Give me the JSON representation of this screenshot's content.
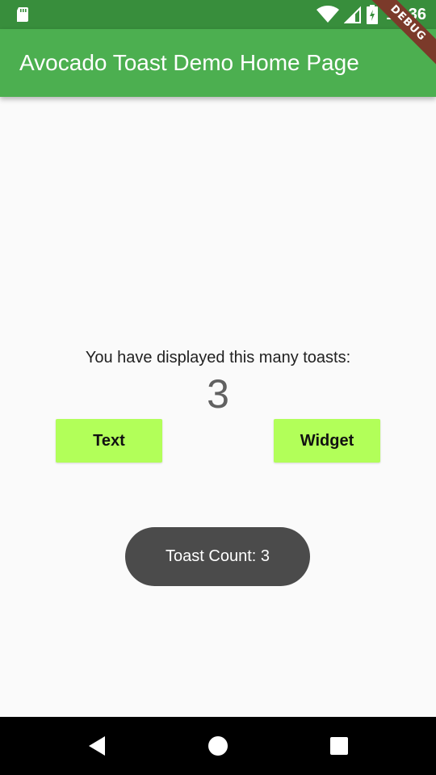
{
  "status_bar": {
    "time": "11:36",
    "icons": [
      "sd-card-icon",
      "wifi-icon",
      "signal-icon",
      "battery-icon"
    ]
  },
  "debug_banner": "DEBUG",
  "app_bar": {
    "title": "Avocado Toast Demo Home Page"
  },
  "main": {
    "description": "You have displayed this many toasts:",
    "count": "3",
    "buttons": {
      "text_label": "Text",
      "widget_label": "Widget"
    }
  },
  "toast": {
    "message": "Toast Count: 3"
  },
  "nav_bar": {
    "icons": [
      "back-icon",
      "home-icon",
      "recents-icon"
    ]
  },
  "colors": {
    "status_bar": "#388e3c",
    "app_bar": "#4caf50",
    "button": "#b2ff59",
    "toast": "#4b4b4b",
    "background": "#fafafa"
  }
}
